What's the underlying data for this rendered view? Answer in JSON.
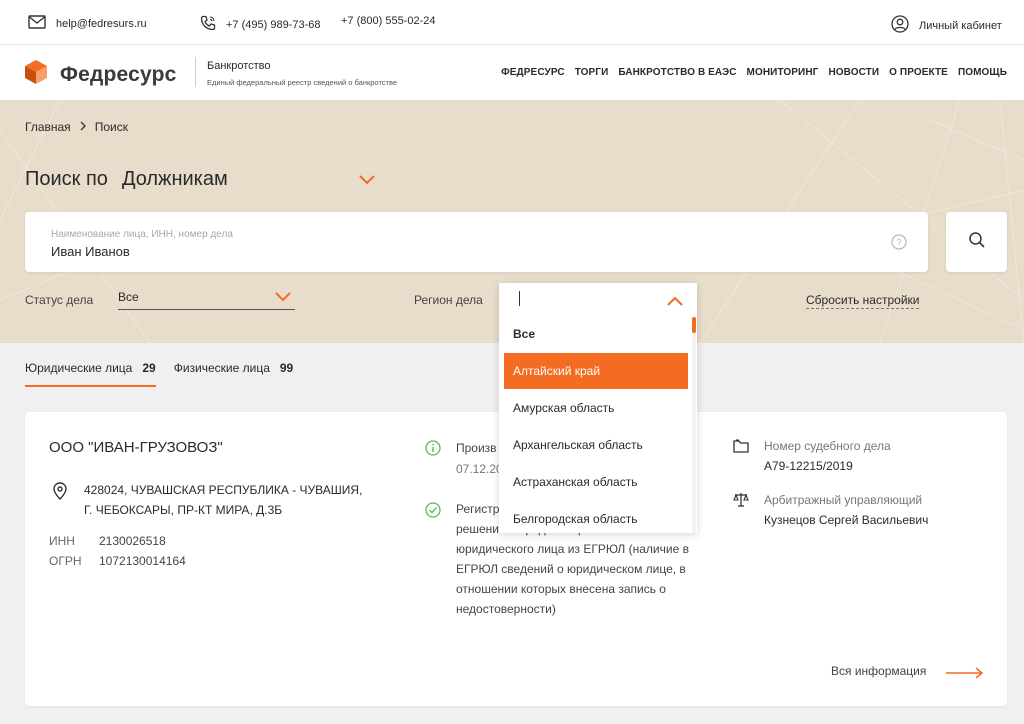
{
  "topbar": {
    "email": "help@fedresurs.ru",
    "phone1": "+7 (495) 989-73-68",
    "phone2": "+7 (800) 555-02-24",
    "cabinet": "Личный кабинет"
  },
  "header": {
    "logo": "Федресурс",
    "subtitle": "Банкротство",
    "subtitle_desc": "Единый федеральный реестр сведений о банкротстве",
    "nav": [
      "ФЕДРЕСУРС",
      "ТОРГИ",
      "БАНКРОТСТВО В ЕАЭС",
      "МОНИТОРИНГ",
      "НОВОСТИ",
      "О ПРОЕКТЕ",
      "ПОМОЩЬ"
    ]
  },
  "breadcrumb": {
    "home": "Главная",
    "current": "Поиск"
  },
  "search": {
    "title_prefix": "Поиск по",
    "title_target": "Должникам",
    "placeholder": "Наименование лица, ИНН, номер дела",
    "value": "Иван Иванов"
  },
  "filters": {
    "status_label": "Статус дела",
    "status_value": "Все",
    "region_label": "Регион дела",
    "reset": "Сбросить настройки"
  },
  "region_dropdown": {
    "input_value": "",
    "options": [
      "Все",
      "Алтайский край",
      "Амурская область",
      "Архангельская область",
      "Астраханская область",
      "Белгородская область"
    ],
    "selected_index": 1
  },
  "tabs": [
    {
      "label": "Юридические лица",
      "count": "29"
    },
    {
      "label": "Физические лица",
      "count": "99"
    }
  ],
  "result": {
    "company": "ООО \"ИВАН-ГРУЗОВОЗ\"",
    "address_line1": "428024, ЧУВАШСКАЯ РЕСПУБЛИКА - ЧУВАШИЯ,",
    "address_line2": "Г. ЧЕБОКСАРЫ, ПР-КТ МИРА, Д.3Б",
    "inn_label": "ИНН",
    "inn": "2130026518",
    "ogrn_label": "ОГРН",
    "ogrn": "1072130014164",
    "event1_title": "Произв",
    "event1_date": "07.12.20",
    "event2_lines": [
      "Регистр",
      "решение о предстоящем исключении",
      "юридического лица из ЕГРЮЛ (наличие в",
      "ЕГРЮЛ сведений о юридическом лице, в",
      "отношении которых внесена запись о",
      "недостоверности)"
    ],
    "case_label": "Номер судебного дела",
    "case_number": "А79-12215/2019",
    "manager_label": "Арбитражный управляющий",
    "manager_name": "Кузнецов Сергей Васильевич",
    "more": "Вся информация"
  },
  "colors": {
    "accent": "#f36c21",
    "hero_bg": "#e8dccb",
    "content_bg": "#f0f0f0"
  }
}
